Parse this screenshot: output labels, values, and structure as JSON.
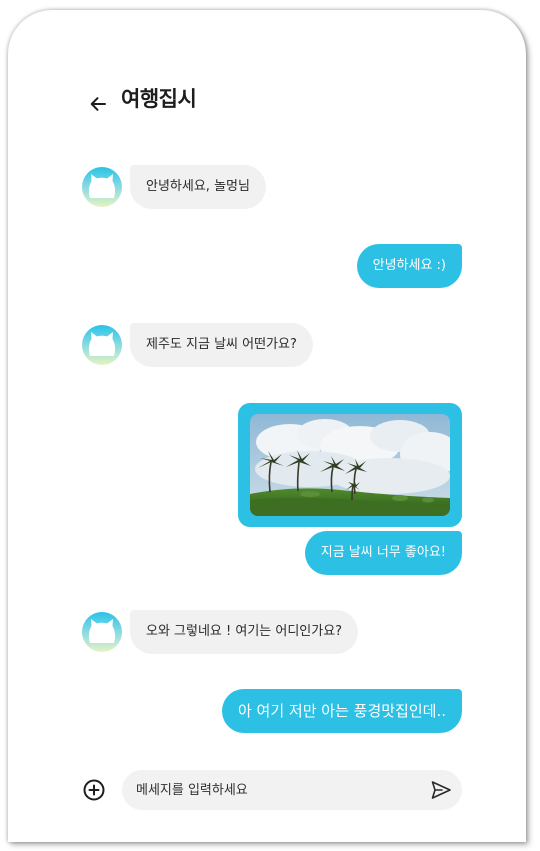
{
  "header": {
    "title": "여행집시",
    "back_icon": "arrow-left-icon"
  },
  "colors": {
    "accent": "#2bc0e4",
    "incoming_bubble": "#f1f1f1",
    "input_background": "#f2f2f2"
  },
  "messages": [
    {
      "side": "in",
      "text": "안녕하세요, 놀멍님"
    },
    {
      "side": "out",
      "text": "안녕하세요 :)"
    },
    {
      "side": "in",
      "text": "제주도 지금 날씨 어떤가요?"
    },
    {
      "side": "out",
      "type": "image",
      "image": "palm-trees-sky-photo"
    },
    {
      "side": "out",
      "text": "지금 날씨 너무 좋아요!"
    },
    {
      "side": "in",
      "text": "오와 그렇네요 ! 여기는 어디인가요?"
    },
    {
      "side": "out",
      "text": "아 여기 저만 아는 풍경맛집인데.."
    }
  ],
  "composer": {
    "placeholder": "메세지를 입력하세요",
    "add_icon": "plus-circle-icon",
    "send_icon": "send-icon"
  }
}
